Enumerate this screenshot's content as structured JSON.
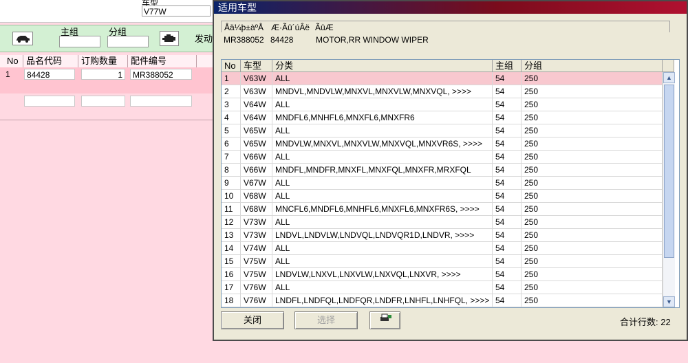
{
  "app": {
    "model_label": "车型",
    "model_value": "V77W",
    "main_group_label": "主组",
    "sub_group_label": "分组",
    "engine_label": "发动",
    "grid_headers": [
      "No",
      "品名代码",
      "订购数量",
      "配件编号"
    ],
    "grid_row": {
      "no": "1",
      "code": "84428",
      "qty": "1",
      "part_no": "MR388052"
    }
  },
  "dialog": {
    "title": "适用车型",
    "info_headers": [
      "Åä¼þ±àºÅ",
      "Æ·Ãû´úÂë",
      "ÃûÆ"
    ],
    "info_values": [
      "MR388052",
      "84428",
      "MOTOR,RR WINDOW WIPER"
    ],
    "table_headers": [
      "No",
      "车型",
      "分类",
      "主组",
      "分组"
    ],
    "rows": [
      [
        "1",
        "V63W",
        "ALL",
        "54",
        "250"
      ],
      [
        "2",
        "V63W",
        "MNDVL,MNDVLW,MNXVL,MNXVLW,MNXVQL, >>>>",
        "54",
        "250"
      ],
      [
        "3",
        "V64W",
        "ALL",
        "54",
        "250"
      ],
      [
        "4",
        "V64W",
        "MNDFL6,MNHFL6,MNXFL6,MNXFR6",
        "54",
        "250"
      ],
      [
        "5",
        "V65W",
        "ALL",
        "54",
        "250"
      ],
      [
        "6",
        "V65W",
        "MNDVLW,MNXVL,MNXVLW,MNXVQL,MNXVR6S, >>>>",
        "54",
        "250"
      ],
      [
        "7",
        "V66W",
        "ALL",
        "54",
        "250"
      ],
      [
        "8",
        "V66W",
        "MNDFL,MNDFR,MNXFL,MNXFQL,MNXFR,MRXFQL",
        "54",
        "250"
      ],
      [
        "9",
        "V67W",
        "ALL",
        "54",
        "250"
      ],
      [
        "10",
        "V68W",
        "ALL",
        "54",
        "250"
      ],
      [
        "11",
        "V68W",
        "MNCFL6,MNDFL6,MNHFL6,MNXFL6,MNXFR6S, >>>>",
        "54",
        "250"
      ],
      [
        "12",
        "V73W",
        "ALL",
        "54",
        "250"
      ],
      [
        "13",
        "V73W",
        "LNDVL,LNDVLW,LNDVQL,LNDVQR1D,LNDVR, >>>>",
        "54",
        "250"
      ],
      [
        "14",
        "V74W",
        "ALL",
        "54",
        "250"
      ],
      [
        "15",
        "V75W",
        "ALL",
        "54",
        "250"
      ],
      [
        "16",
        "V75W",
        "LNDVLW,LNXVL,LNXVLW,LNXVQL,LNXVR, >>>>",
        "54",
        "250"
      ],
      [
        "17",
        "V76W",
        "ALL",
        "54",
        "250"
      ],
      [
        "18",
        "V76W",
        "LNDFL,LNDFQL,LNDFQR,LNDFR,LNHFL,LNHFQL, >>>>",
        "54",
        "250"
      ]
    ],
    "selected_row": 1,
    "close_label": "关闭",
    "select_label": "选择",
    "total_label": "合计行数: 22",
    "colors": {
      "selected_outline": "#d81b2c",
      "selected_fill": "#f8c8cf",
      "titlebar": "#7a0c1c"
    }
  }
}
